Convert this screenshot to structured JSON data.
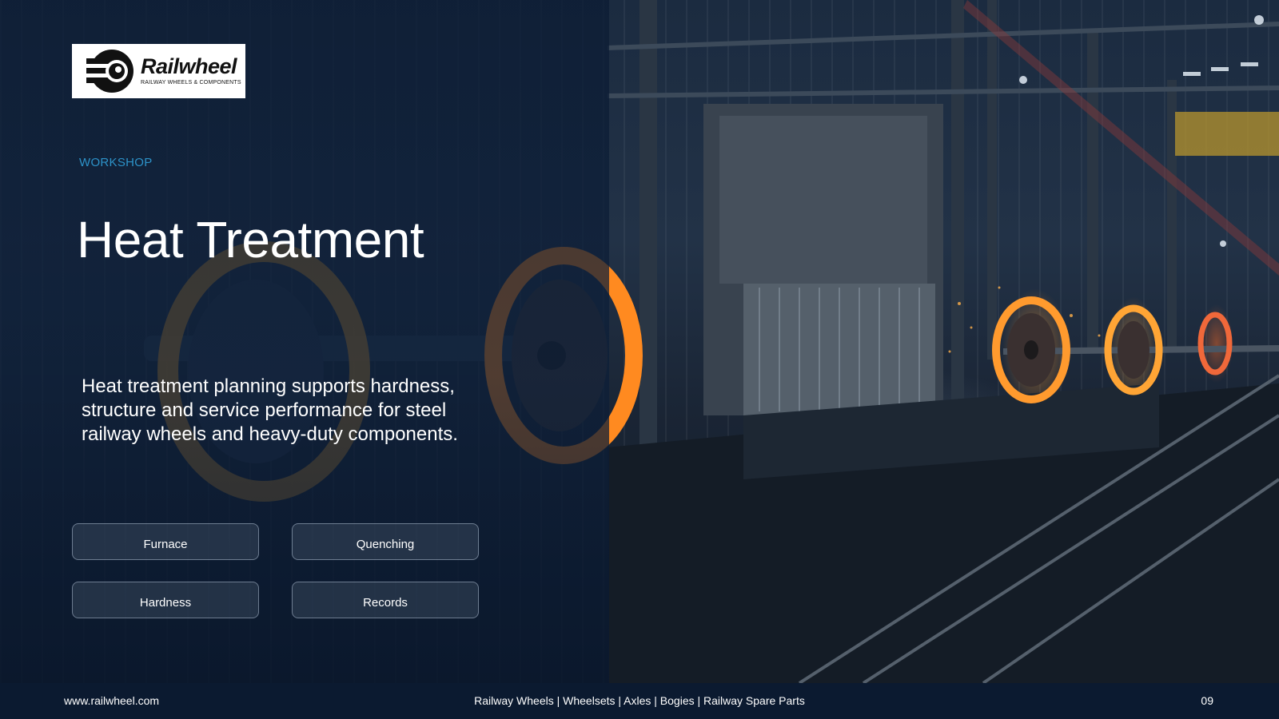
{
  "logo": {
    "name": "Railwheel",
    "tagline": "RAILWAY WHEELS & COMPONENTS"
  },
  "slide": {
    "eyebrow": "WORKSHOP",
    "title": "Heat Treatment",
    "description": "Heat treatment planning supports hardness, structure and service performance for steel railway wheels and heavy-duty components.",
    "chips": [
      "Furnace",
      "Quenching",
      "Hardness",
      "Records"
    ]
  },
  "footer": {
    "url": "www.railwheel.com",
    "tagline": "Railway Wheels | Wheelsets | Axles | Bogies | Railway Spare Parts",
    "page_number": "09"
  },
  "colors": {
    "panel": "#0c1c34",
    "accent": "#2d93c9",
    "footer_bg": "#0b1a30",
    "glow": "#ff9a2e"
  }
}
